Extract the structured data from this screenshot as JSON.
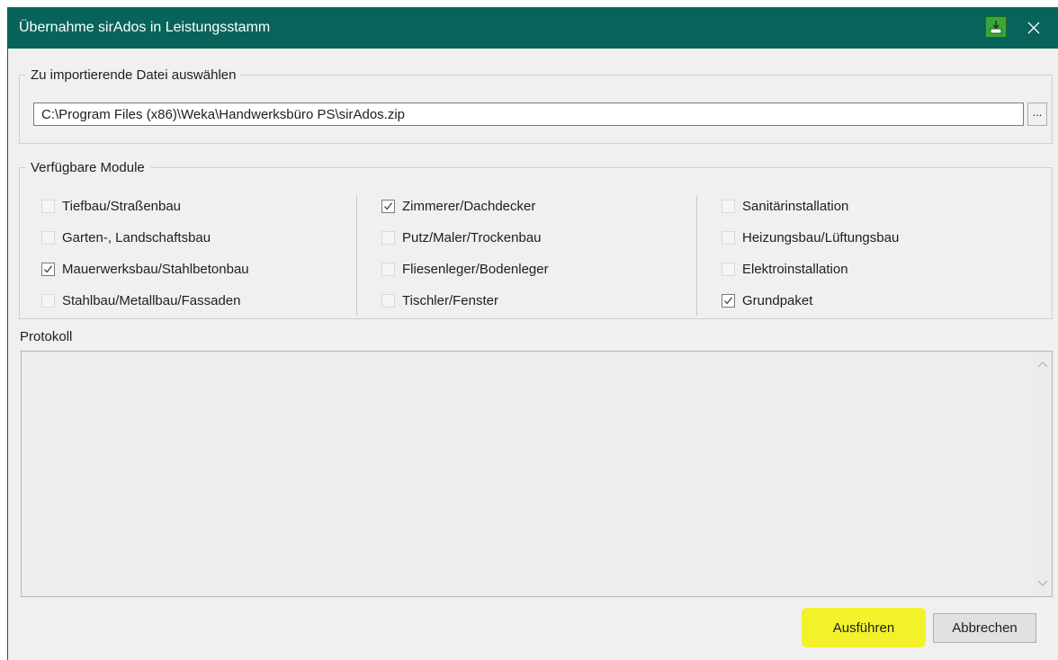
{
  "window": {
    "title": "Übernahme sirAdos in Leistungsstamm"
  },
  "file_section": {
    "legend": "Zu importierende Datei auswählen",
    "path_value": "C:\\Program Files (x86)\\Weka\\Handwerksbüro PS\\sirAdos.zip",
    "browse_label": "..."
  },
  "modules": {
    "legend": "Verfügbare Module",
    "columns": [
      [
        {
          "label": "Tiefbau/Straßenbau",
          "checked": false
        },
        {
          "label": "Garten-, Landschaftsbau",
          "checked": false
        },
        {
          "label": "Mauerwerksbau/Stahlbetonbau",
          "checked": true
        },
        {
          "label": "Stahlbau/Metallbau/Fassaden",
          "checked": false
        }
      ],
      [
        {
          "label": "Zimmerer/Dachdecker",
          "checked": true
        },
        {
          "label": "Putz/Maler/Trockenbau",
          "checked": false
        },
        {
          "label": "Fliesenleger/Bodenleger",
          "checked": false
        },
        {
          "label": "Tischler/Fenster",
          "checked": false
        }
      ],
      [
        {
          "label": "Sanitärinstallation",
          "checked": false
        },
        {
          "label": "Heizungsbau/Lüftungsbau",
          "checked": false
        },
        {
          "label": "Elektroinstallation",
          "checked": false
        },
        {
          "label": "Grundpaket",
          "checked": true
        }
      ]
    ]
  },
  "protokoll": {
    "label": "Protokoll"
  },
  "buttons": {
    "run": "Ausführen",
    "cancel": "Abbrechen"
  },
  "colors": {
    "titlebar": "#08645a",
    "highlight": "#f3f22a"
  },
  "icons": {
    "title_app": "import-app-icon",
    "close": "close-icon",
    "scroll_up": "chevron-up-icon",
    "scroll_down": "chevron-down-icon",
    "checkmark": "checkmark-icon"
  }
}
